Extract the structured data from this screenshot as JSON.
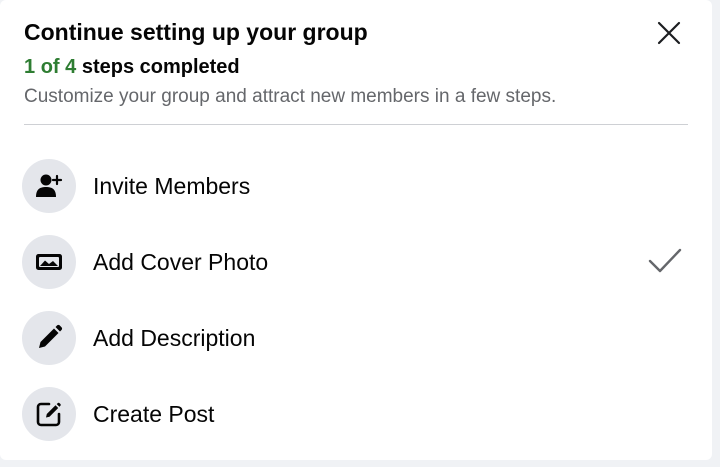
{
  "header": {
    "title": "Continue setting up your group",
    "progress_done": "1",
    "progress_of": "of",
    "progress_total": "4",
    "progress_suffix": "steps completed",
    "subtitle": "Customize your group and attract new members in a few steps."
  },
  "steps": [
    {
      "label": "Invite Members",
      "icon": "add-person-icon",
      "completed": false
    },
    {
      "label": "Add Cover Photo",
      "icon": "cover-photo-icon",
      "completed": true
    },
    {
      "label": "Add Description",
      "icon": "pencil-icon",
      "completed": false
    },
    {
      "label": "Create Post",
      "icon": "edit-post-icon",
      "completed": false
    }
  ],
  "colors": {
    "progress_accent": "#2e7d32",
    "icon_bg": "#e4e6eb",
    "text_primary": "#050505",
    "text_secondary": "#65676b"
  }
}
